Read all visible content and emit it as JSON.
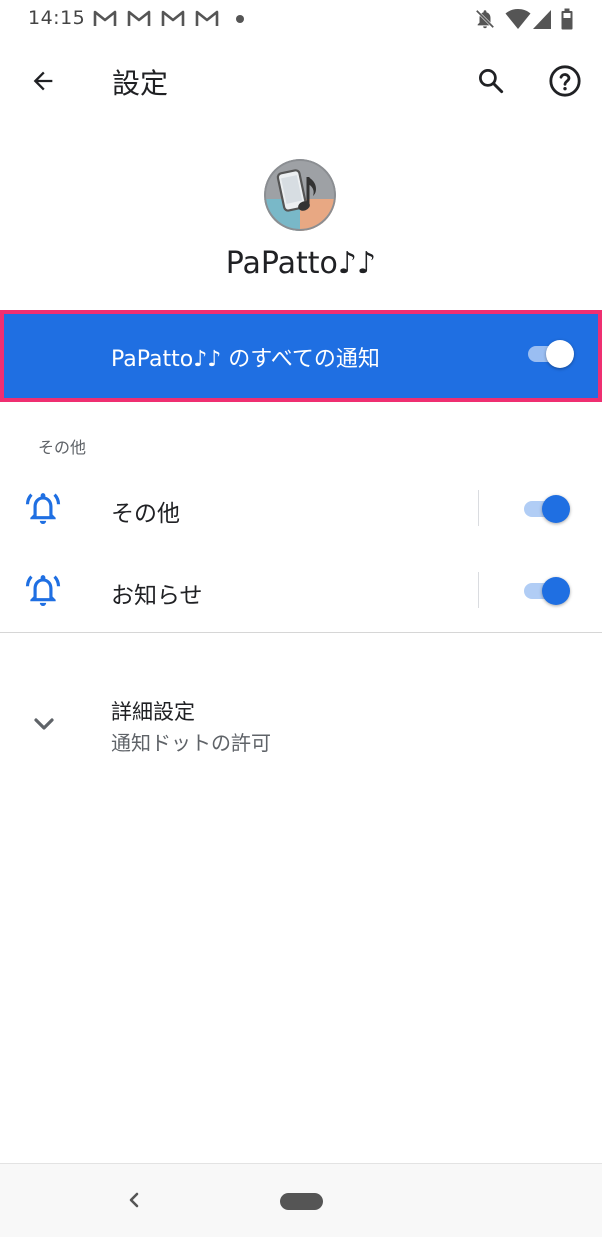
{
  "status_bar": {
    "time": "14:15",
    "notification_icons": [
      "gmail-icon",
      "gmail-icon",
      "gmail-icon",
      "gmail-icon",
      "dot-icon"
    ],
    "system_icons": [
      "notifications-off-icon",
      "wifi-icon",
      "cellular-icon",
      "battery-icon"
    ]
  },
  "app_bar": {
    "title": "設定",
    "icons": [
      "back-arrow-icon",
      "search-icon",
      "help-icon"
    ]
  },
  "app_header": {
    "name": "PaPatto♪♪",
    "icon": "papatto-app-icon"
  },
  "master_toggle": {
    "label": "PaPatto♪♪ のすべての通知",
    "on": true,
    "highlight_color": "#ef2f71",
    "background_color": "#1f6fe2"
  },
  "category": {
    "header": "その他",
    "channels": [
      {
        "label": "その他",
        "icon": "bell-ringing-icon",
        "on": true
      },
      {
        "label": "お知らせ",
        "icon": "bell-ringing-icon",
        "on": true
      }
    ]
  },
  "advanced": {
    "title": "詳細設定",
    "summary": "通知ドットの許可",
    "icon": "chevron-down-icon"
  },
  "nav_bar": {
    "icons": [
      "nav-back-icon",
      "home-pill-icon"
    ]
  },
  "colors": {
    "accent": "#1f6fe2",
    "highlight_border": "#ef2f71"
  }
}
